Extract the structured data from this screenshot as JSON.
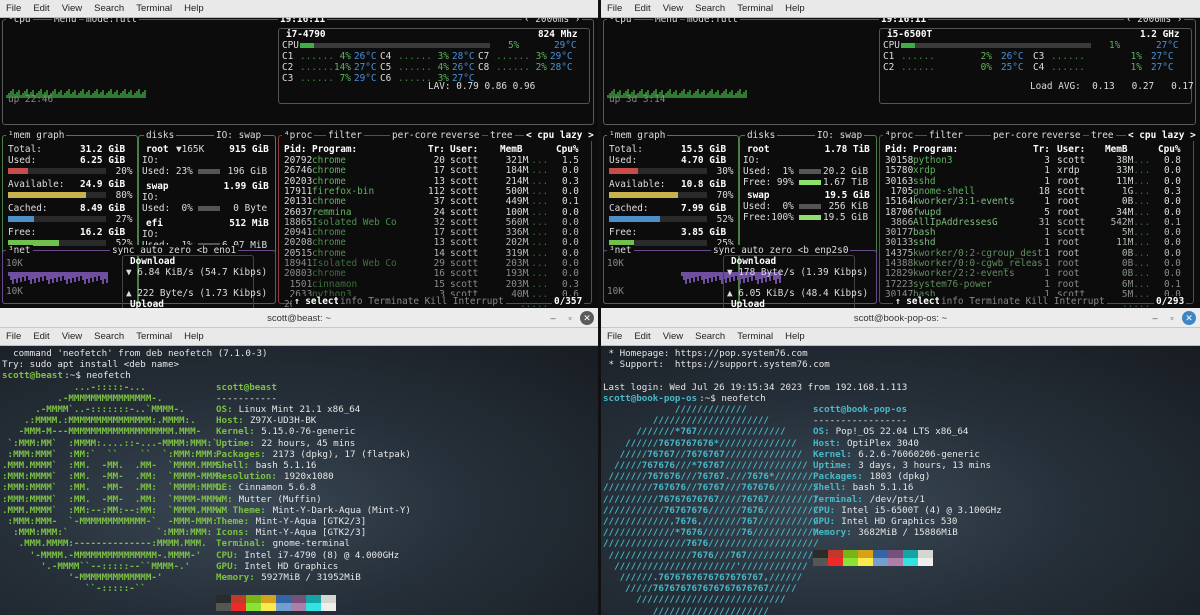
{
  "menu": [
    "File",
    "Edit",
    "View",
    "Search",
    "Terminal",
    "Help"
  ],
  "btop_left": {
    "header": {
      "cpu": "¹cpu",
      "menu": "Menu",
      "mode": "mode:full",
      "time": "19:16:11",
      "refresh": "2000ms"
    },
    "cpu_name": "i7-4790",
    "freq": "824 Mhz",
    "cpu_total": {
      "label": "CPU",
      "pct": "5%",
      "temp": "29°C"
    },
    "cores": [
      [
        "C1",
        "4%",
        "26°C",
        "C4",
        "3%",
        "28°C",
        "C7",
        "3%",
        "29°C"
      ],
      [
        "C2",
        "14%",
        "27°C",
        "C5",
        "4%",
        "26°C",
        "C8",
        "2%",
        "28°C"
      ],
      [
        "C3",
        "7%",
        "29°C",
        "C6",
        "3%",
        "27°C",
        "",
        "",
        ""
      ]
    ],
    "lav": "LAV: 0.79 0.86 0.96",
    "uptime": "up 22:46",
    "mem": {
      "total": "31.2 GiB",
      "used": "6.25 GiB",
      "used_pct": "20%",
      "avail": "24.9 GiB",
      "avail_pct": "80%",
      "cached": "8.49 GiB",
      "cached_pct": "27%",
      "free": "16.2 GiB",
      "free_pct": "52%"
    },
    "disks": [
      {
        "name": "root",
        "tag": "▼165K",
        "size": "915 GiB",
        "io": "IO:",
        "used": "Used: 23%",
        "val": "196 GiB"
      },
      {
        "name": "swap",
        "tag": "",
        "size": "1.99 GiB",
        "io": "IO:",
        "used": "Used:  0%",
        "val": "0 Byte"
      },
      {
        "name": "efi",
        "tag": "",
        "size": "512 MiB",
        "io": "IO:",
        "used": "Used:  1%",
        "val": "6.07 MiB"
      }
    ],
    "proc_header": [
      "Pid:",
      "Program:",
      "Tr:",
      "User:",
      "MemB",
      "Cpu%"
    ],
    "procs": [
      [
        "20792",
        "chrome",
        "20",
        "scott",
        "321M",
        "1.5"
      ],
      [
        "26746",
        "chrome",
        "17",
        "scott",
        "184M",
        "0.0"
      ],
      [
        "20203",
        "chrome",
        "13",
        "scott",
        "214M",
        "0.3"
      ],
      [
        "17911",
        "firefox-bin",
        "112",
        "scott",
        "500M",
        "0.0"
      ],
      [
        "20131",
        "chrome",
        "37",
        "scott",
        "449M",
        "0.1"
      ],
      [
        "26037",
        "remmina",
        "24",
        "scott",
        "100M",
        "0.0"
      ],
      [
        "18865",
        "Isolated Web Co",
        "32",
        "scott",
        "560M",
        "0.0"
      ],
      [
        "20941",
        "chrome",
        "17",
        "scott",
        "336M",
        "0.0"
      ],
      [
        "20208",
        "chrome",
        "13",
        "scott",
        "202M",
        "0.0"
      ],
      [
        "20515",
        "chrome",
        "14",
        "scott",
        "319M",
        "0.0"
      ],
      [
        "18941",
        "Isolated Web Co",
        "29",
        "scott",
        "203M",
        "0.0"
      ],
      [
        "20803",
        "chrome",
        "16",
        "scott",
        "193M",
        "0.0"
      ],
      [
        "1501",
        "cinnamon",
        "15",
        "scott",
        "203M",
        "0.3"
      ],
      [
        "2633",
        "python3",
        "3",
        "scott",
        "40M",
        "0.6"
      ],
      [
        "20334",
        "chrome",
        "",
        "",
        "",
        "0.0"
      ]
    ],
    "proc_count": "0/357",
    "net_iface": "eno1",
    "net": {
      "scale": "10K",
      "download": "Download",
      "down_rate": "▼ 6.84 KiB/s (54.7 Kibps)",
      "up_rate": "▲ 222 Byte/s (1.73 Kibps)",
      "upload": "Upload"
    }
  },
  "btop_right": {
    "header": {
      "cpu": "¹cpu",
      "menu": "Menu",
      "mode": "mode:full",
      "time": "19:16:11",
      "refresh": "2000ms"
    },
    "cpu_name": "i5-6500T",
    "freq": "1.2 GHz",
    "cpu_total": {
      "label": "CPU",
      "pct": "1%",
      "temp": "27°C"
    },
    "cores": [
      [
        "C1",
        "2%",
        "26°C",
        "C3",
        "1%",
        "27°C"
      ],
      [
        "C2",
        "0%",
        "25°C",
        "C4",
        "1%",
        "27°C"
      ]
    ],
    "lav": "Load AVG:  0.13   0.27   0.17",
    "uptime": "up 3d 3:14",
    "mem": {
      "total": "15.5 GiB",
      "used": "4.70 GiB",
      "used_pct": "30%",
      "avail": "10.8 GiB",
      "avail_pct": "70%",
      "cached": "7.99 GiB",
      "cached_pct": "52%",
      "free": "3.85 GiB",
      "free_pct": "25%"
    },
    "disks": [
      {
        "name": "root",
        "size": "1.78 TiB",
        "io": "IO:",
        "used": "Used:  1%",
        "val": "20.2 GiB",
        "free": "Free: 99%",
        "fval": "1.67 TiB"
      },
      {
        "name": "swap",
        "size": "19.5 GiB",
        "used": "Used:  0%",
        "val": "256 KiB",
        "free": "Free:100%",
        "fval": "19.5 GiB"
      }
    ],
    "proc_header": [
      "Pid:",
      "Program:",
      "Tr:",
      "User:",
      "MemB",
      "Cpu%"
    ],
    "procs": [
      [
        "30158",
        "python3",
        "3",
        "scott",
        "38M",
        "0.8"
      ],
      [
        "15780",
        "xrdp",
        "1",
        "xrdp",
        "33M",
        "0.0"
      ],
      [
        "30163",
        "sshd",
        "1",
        "root",
        "11M",
        "0.0"
      ],
      [
        "1705",
        "gnome-shell",
        "18",
        "scott",
        "1G",
        "0.3"
      ],
      [
        "15164",
        "kworker/3:1-events",
        "1",
        "root",
        "0B",
        "0.0"
      ],
      [
        "18706",
        "fwupd",
        "5",
        "root",
        "34M",
        "0.0"
      ],
      [
        "3866",
        "AllIpAddressesG",
        "31",
        "scott",
        "542M",
        "0.1"
      ],
      [
        "30177",
        "bash",
        "1",
        "scott",
        "5M",
        "0.0"
      ],
      [
        "30133",
        "sshd",
        "1",
        "root",
        "11M",
        "0.0"
      ],
      [
        "14375",
        "kworker/0:2-cgroup_dest",
        "1",
        "root",
        "0B",
        "0.0"
      ],
      [
        "14388",
        "kworker/0:0-cgwb_releas",
        "1",
        "root",
        "0B",
        "0.0"
      ],
      [
        "12829",
        "kworker/2:2-events",
        "1",
        "root",
        "0B",
        "0.0"
      ],
      [
        "17223",
        "system76-power",
        "1",
        "root",
        "6M",
        "0.1"
      ],
      [
        "30147",
        "bash",
        "1",
        "scott",
        "5M",
        "0.0"
      ],
      [
        "",
        "",
        "",
        "",
        "",
        "0.0"
      ]
    ],
    "proc_count": "0/293",
    "net_iface": "enp2s0",
    "net": {
      "scale": "10K",
      "download": "Download",
      "down_rate": "▼ 178 Byte/s (1.39 Kibps)",
      "up_rate": "▲ 6.05 KiB/s (48.4 Kibps)",
      "upload": "Upload"
    }
  },
  "btop_labels": {
    "mem": "¹mem",
    "graph": "graph",
    "disks": "disks",
    "io": "IO:",
    "swap": "swap",
    "proc": "⁴proc",
    "filter": "filter",
    "percore": "per-core",
    "reverse": "reverse",
    "tree": "tree",
    "sort": "< cpu lazy >",
    "net": "³net",
    "sync": "sync",
    "auto": "auto",
    "zero": "zero",
    "bracket": "<b",
    "select": "↑ select ↓",
    "info": "info",
    "terminate": "Terminate",
    "kill": "Kill",
    "interrupt": "Interrupt",
    "total": "Total:",
    "used": "Used:",
    "available": "Available:",
    "cached": "Cached:",
    "free": "Free:"
  },
  "term_left": {
    "title": "scott@beast: ~",
    "pre": [
      "  command 'neofetch' from deb neofetch (7.1.0-3)",
      "Try: sudo apt install <deb name>"
    ],
    "prompt_user": "scott@beast",
    "prompt_rest": ":~$ neofetch",
    "logo": [
      "             ...-:::::-...",
      "          .-MMMMMMMMMMMMMMM-.",
      "      .-MMMM`..-:::::::-..`MMMM-.",
      "    .:MMMM.:MMMMMMMMMMMMMMM:.MMMM:.",
      "   -MMM-M---MMMMMMMMMMMMMMMMMMM.MMM-",
      " `:MMM:MM`  :MMMM:....::-...-MMMM:MMM:`",
      " :MMM:MMM`  :MM:`  ``    ``  `:MMM:MMM:",
      ".MMM.MMMM`  :MM.  -MM.  .MM-  `MMMM.MMM.",
      ":MMM:MMMM`  :MM.  -MM-  .MM:  `MMMM-MMM:",
      ":MMM:MMMM`  :MM.  -MM-  .MM:  `MMMM:MMM:",
      ":MMM:MMMM`  :MM.  -MM-  .MM:  `MMMM-MMM:",
      ".MMM.MMMM`  :MM:--:MM:--:MM:  `MMMM.MMM.",
      " :MMM:MMM-  `-MMMMMMMMMMMM-`  -MMM-MMM:",
      "  :MMM:MMM:`                `:MMM:MMM:",
      "   .MMM.MMMM:--------------:MMMM.MMM.",
      "     '-MMMM.-MMMMMMMMMMMMMMM-.MMMM-'",
      "       '.-MMMM``--:::::--``MMMM-.'",
      "            '-MMMMMMMMMMMMM-'",
      "               ``-:::::-``"
    ],
    "info_user": "scott@beast",
    "info_sep": "-----------",
    "info": [
      [
        "OS: ",
        "Linux Mint 21.1 x86_64"
      ],
      [
        "Host: ",
        "Z97X-UD3H-BK"
      ],
      [
        "Kernel: ",
        "5.15.0-76-generic"
      ],
      [
        "Uptime: ",
        "22 hours, 45 mins"
      ],
      [
        "Packages: ",
        "2173 (dpkg), 17 (flatpak)"
      ],
      [
        "Shell: ",
        "bash 5.1.16"
      ],
      [
        "Resolution: ",
        "1920x1080"
      ],
      [
        "DE: ",
        "Cinnamon 5.6.8"
      ],
      [
        "WM: ",
        "Mutter (Muffin)"
      ],
      [
        "WM Theme: ",
        "Mint-Y-Dark-Aqua (Mint-Y)"
      ],
      [
        "Theme: ",
        "Mint-Y-Aqua [GTK2/3]"
      ],
      [
        "Icons: ",
        "Mint-Y-Aqua [GTK2/3]"
      ],
      [
        "Terminal: ",
        "gnome-terminal"
      ],
      [
        "CPU: ",
        "Intel i7-4790 (8) @ 4.000GHz"
      ],
      [
        "GPU: ",
        "Intel HD Graphics"
      ],
      [
        "Memory: ",
        "5927MiB / 31952MiB"
      ]
    ]
  },
  "term_right": {
    "title": "scott@book-pop-os: ~",
    "pre": [
      " * Homepage: https://pop.system76.com",
      " * Support:  https://support.system76.com",
      "",
      "Last login: Wed Jul 26 19:15:34 2023 from 192.168.1.113"
    ],
    "prompt_user": "scott@book-pop-os",
    "prompt_rest": ":~$ neofetch",
    "logo": [
      "             /////////////",
      "         /////////////////////",
      "      ///////*767////////////////",
      "    //////7676767676*//////////////",
      "   /////76767//7676767//////////////",
      "  /////767676///*76767///////////////",
      " ///////767676///76767.///7676*///////",
      "/////////767676//76767///767676////////",
      "//////////76767676767////76767/////////",
      "///////////76767676//////7676//////////",
      "////////////,7676,///////767///////////",
      "/////////////*7676///////76////////////",
      "///////////////7676////////////////////",
      " ///////////////7676///767////////////",
      "  //////////////////////'////////////",
      "   //////.7676767676767676767,//////",
      "    /////767676767676767676767/////",
      "      ///////////////////////////",
      "         /////////////////////",
      "             /////////////"
    ],
    "info_user": "scott@book-pop-os",
    "info_sep": "-----------------",
    "info": [
      [
        "OS: ",
        "Pop!_OS 22.04 LTS x86_64"
      ],
      [
        "Host: ",
        "OptiPlex 3040"
      ],
      [
        "Kernel: ",
        "6.2.6-76060206-generic"
      ],
      [
        "Uptime: ",
        "3 days, 3 hours, 13 mins"
      ],
      [
        "Packages: ",
        "1803 (dpkg)"
      ],
      [
        "Shell: ",
        "bash 5.1.16"
      ],
      [
        "Terminal: ",
        "/dev/pts/1"
      ],
      [
        "CPU: ",
        "Intel i5-6500T (4) @ 3.100GHz"
      ],
      [
        "GPU: ",
        "Intel HD Graphics 530"
      ],
      [
        "Memory: ",
        "3682MiB / 15886MiB"
      ]
    ]
  },
  "colors": {
    "swatch_row1": [
      "#2b2b2b",
      "#c0392b",
      "#7ab317",
      "#d6a21a",
      "#3465a4",
      "#75507b",
      "#16a3a3",
      "#d3d7cf"
    ],
    "swatch_row2": [
      "#555753",
      "#ef2929",
      "#8ae234",
      "#fce94f",
      "#729fcf",
      "#ad7fa8",
      "#34e2e2",
      "#eeeeec"
    ],
    "mint_green": "#7cc143",
    "pop_cyan": "#48b9c7",
    "pop_orange": "#f7a21b"
  }
}
